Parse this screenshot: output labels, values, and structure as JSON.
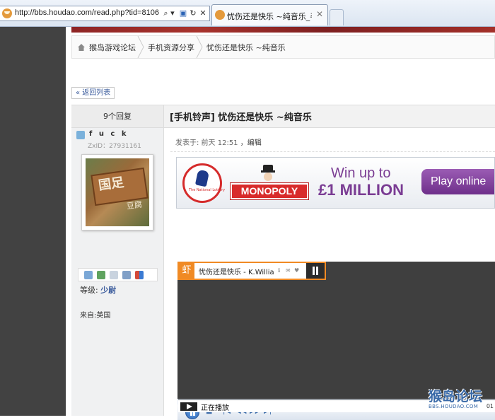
{
  "browser": {
    "url": "http://bbs.houdao.com/read.php?tid=8106",
    "tab_title": "忧伤还是快乐 ~纯音乐_手...",
    "search_btn": "⌕ ▾",
    "compat_btn": "▣",
    "refresh_btn": "↻",
    "stop_btn": "✕",
    "tab_close": "✕"
  },
  "breadcrumb": [
    "猴岛游戏论坛",
    "手机资源分享",
    "忧伤还是快乐 ~纯音乐"
  ],
  "back_button": "« 返回列表",
  "thread": {
    "reply_count": "9个回复",
    "title": "[手机铃声] 忧伤还是快乐  ~纯音乐"
  },
  "author": {
    "username": "f u c k",
    "uid": "ZxID：27931161",
    "avatar_text": "国足",
    "avatar_text2": "豆腐",
    "level_label": "等级:",
    "level_value": "少尉",
    "from": "来自:英国"
  },
  "post": {
    "meta": "发表于: 前天  12:51",
    "edit": "，编辑"
  },
  "ad": {
    "lottery_text": "The National Lottery",
    "brand": "MONOPOLY",
    "headline1": "Win up to",
    "headline2": "£1 MILLION",
    "cta": "Play online"
  },
  "player": {
    "logo": "虾",
    "song": "忧伤还是快乐 - K.William",
    "icons": [
      "ℹ",
      "✉",
      "♥"
    ],
    "controls": [
      "■",
      "|◀",
      "◀◀",
      "▶▶",
      "▶|"
    ],
    "status": "正在播放",
    "time": "01"
  },
  "watermark": {
    "main": "猴岛论坛",
    "sub": "BBS.HOUDAO.COM"
  }
}
